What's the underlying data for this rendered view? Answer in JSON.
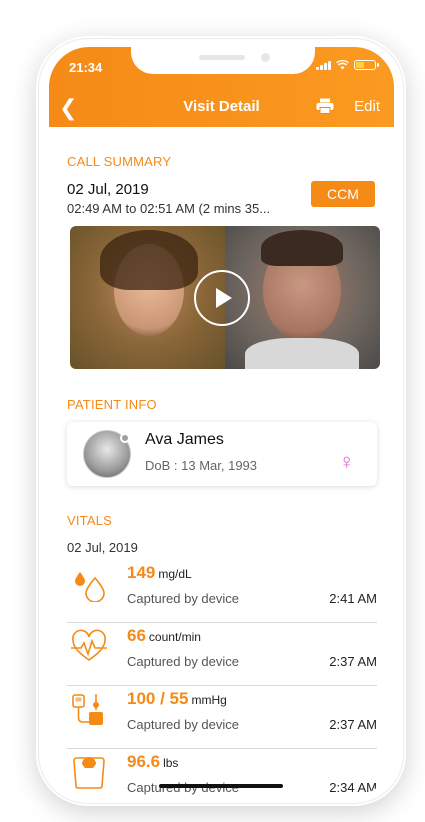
{
  "status_bar": {
    "time": "21:34"
  },
  "nav": {
    "title": "Visit Detail",
    "edit_label": "Edit",
    "back_icon": "chevron-left-icon",
    "print_icon": "printer-icon"
  },
  "call_summary": {
    "section_label": "CALL SUMMARY",
    "date": "02 Jul, 2019",
    "time_range": "02:49 AM to 02:51 AM (2 mins 35...",
    "badge": "CCM"
  },
  "patient_info": {
    "section_label": "PATIENT INFO",
    "name": "Ava James",
    "dob": "DoB : 13 Mar, 1993",
    "gender_icon": "female-icon"
  },
  "vitals": {
    "section_label": "VITALS",
    "date": "02 Jul, 2019",
    "items": [
      {
        "icon": "blood-drop-icon",
        "value": "149",
        "unit": "mg/dL",
        "source": "Captured by device",
        "time": "2:41 AM"
      },
      {
        "icon": "heart-rate-icon",
        "value": "66",
        "unit": "count/min",
        "source": "Captured by device",
        "time": "2:37 AM"
      },
      {
        "icon": "blood-pressure-icon",
        "value": "100 / 55",
        "unit": "mmHg",
        "source": "Captured by device",
        "time": "2:37 AM"
      },
      {
        "icon": "weight-scale-icon",
        "value": "96.6",
        "unit": "lbs",
        "source": "Captured by device",
        "time": "2:34 AM"
      }
    ]
  },
  "colors": {
    "accent": "#f58a17",
    "female": "#d96bd7"
  }
}
